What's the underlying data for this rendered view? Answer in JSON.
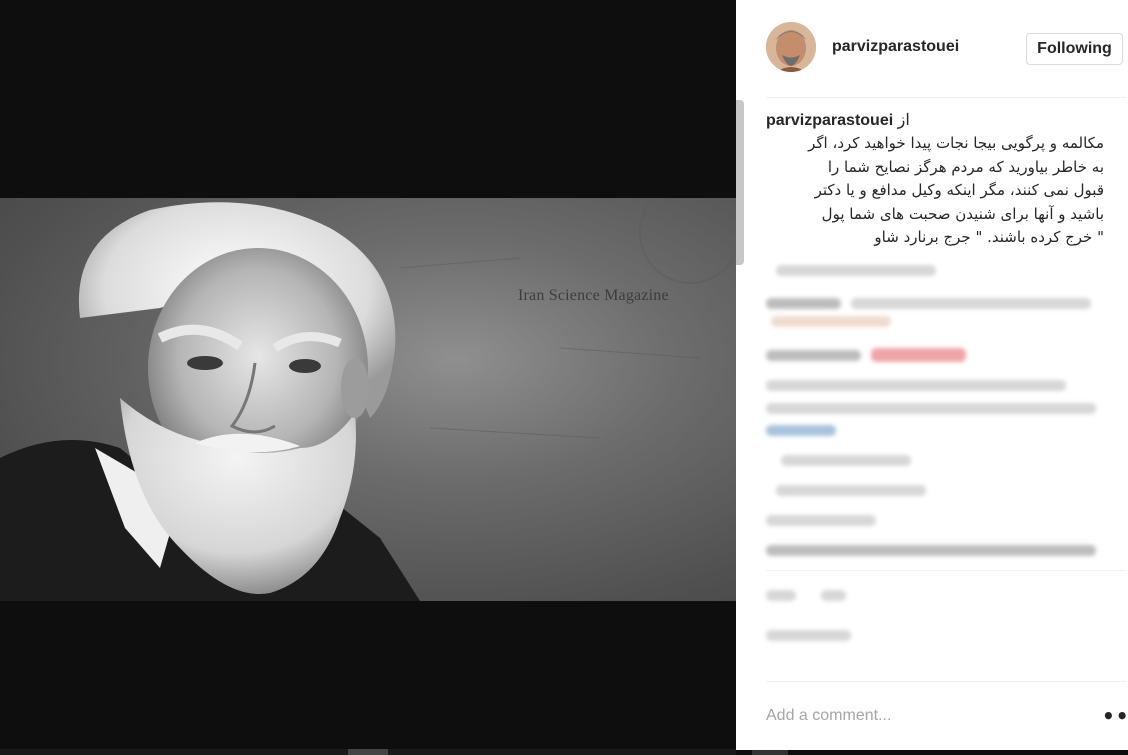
{
  "post": {
    "username": "parvizparastouei",
    "follow_label": "Following",
    "via_prefix": "از",
    "via_user": "parvizparastouei",
    "caption": "مکالمه و پرگویی بیجا نجات پیدا خواهید کرد، اگر\nبه خاطر بیاورید که مردم هرگز نصایح شما را\nقبول نمی کنند، مگر اینکه وکیل مدافع و یا دکتر\nباشید و آنها برای شنیدن صحبت های شما پول\n\" خرج کرده باشند. \" جرج برنارد شاو",
    "image_watermark": "Iran Science Magazine"
  },
  "comment_box": {
    "placeholder": "Add a comment...",
    "more_label": "•••"
  },
  "colors": {
    "panel_bg": "#ffffff",
    "page_bg": "#0e0e0e",
    "text": "#262626",
    "placeholder": "#a5a5a5",
    "border": "#dbdbdb"
  }
}
